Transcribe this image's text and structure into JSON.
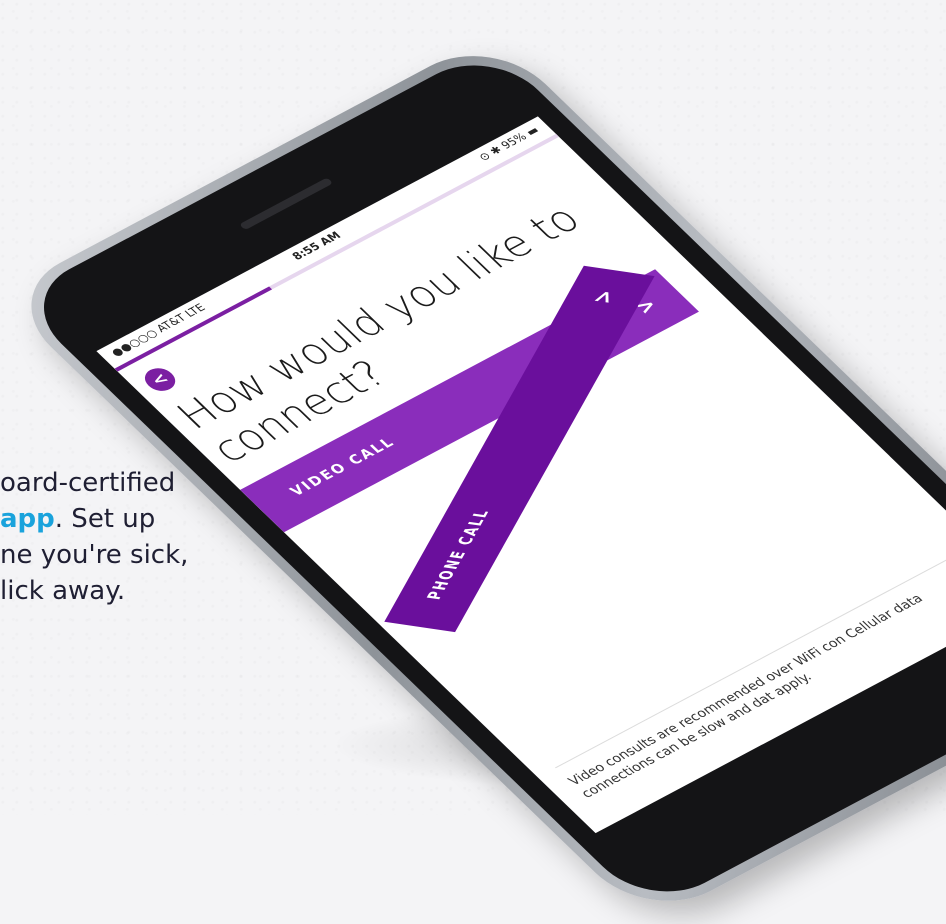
{
  "promo": {
    "accent": "!",
    "lines": [
      "oard-certified",
      {
        "highlight": "app",
        "rest": ". Set up"
      },
      "ne you're sick,",
      "lick away."
    ]
  },
  "status_bar": {
    "carrier": "●●○○○ AT&T  LTE",
    "time": "8:55 AM",
    "battery": "⊙ ✱ 95% ▬"
  },
  "progress": {
    "fraction": 0.35
  },
  "screen": {
    "back_icon": "<",
    "title": "How would you like to connect?",
    "options": [
      {
        "label": "VIDEO CALL",
        "arrow": ">"
      },
      {
        "label": "PHONE CALL",
        "arrow": ">"
      }
    ],
    "footer": "Video consults are recommended over WiFi con Cellular data connections can be slow and dat apply."
  },
  "colors": {
    "brand_purple": "#6a0f9c",
    "highlight_blue": "#1aa3dc"
  }
}
